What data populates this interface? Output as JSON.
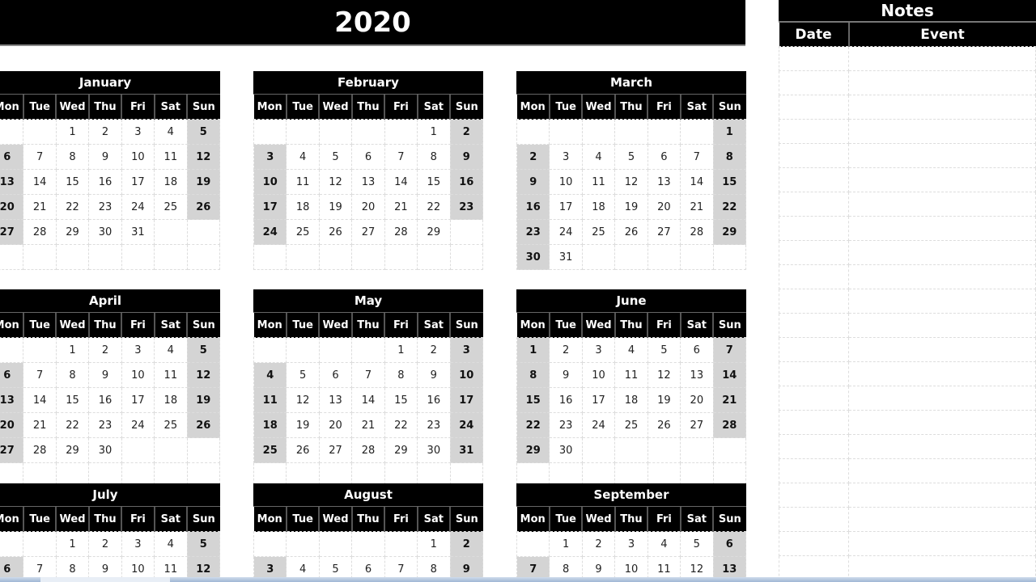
{
  "year_title": "2020",
  "weekday_headers": [
    "Mon",
    "Tue",
    "Wed",
    "Thu",
    "Fri",
    "Sat",
    "Sun"
  ],
  "months": [
    {
      "name": "January",
      "weeks": [
        [
          "",
          "",
          "1",
          "2",
          "3",
          "4",
          "5"
        ],
        [
          "6",
          "7",
          "8",
          "9",
          "10",
          "11",
          "12"
        ],
        [
          "13",
          "14",
          "15",
          "16",
          "17",
          "18",
          "19"
        ],
        [
          "20",
          "21",
          "22",
          "23",
          "24",
          "25",
          "26"
        ],
        [
          "27",
          "28",
          "29",
          "30",
          "31",
          "",
          ""
        ],
        [
          "",
          "",
          "",
          "",
          "",
          "",
          ""
        ]
      ]
    },
    {
      "name": "February",
      "weeks": [
        [
          "",
          "",
          "",
          "",
          "",
          "1",
          "2"
        ],
        [
          "3",
          "4",
          "5",
          "6",
          "7",
          "8",
          "9"
        ],
        [
          "10",
          "11",
          "12",
          "13",
          "14",
          "15",
          "16"
        ],
        [
          "17",
          "18",
          "19",
          "20",
          "21",
          "22",
          "23"
        ],
        [
          "24",
          "25",
          "26",
          "27",
          "28",
          "29",
          ""
        ],
        [
          "",
          "",
          "",
          "",
          "",
          "",
          ""
        ]
      ]
    },
    {
      "name": "March",
      "weeks": [
        [
          "",
          "",
          "",
          "",
          "",
          "",
          "1"
        ],
        [
          "2",
          "3",
          "4",
          "5",
          "6",
          "7",
          "8"
        ],
        [
          "9",
          "10",
          "11",
          "12",
          "13",
          "14",
          "15"
        ],
        [
          "16",
          "17",
          "18",
          "19",
          "20",
          "21",
          "22"
        ],
        [
          "23",
          "24",
          "25",
          "26",
          "27",
          "28",
          "29"
        ],
        [
          "30",
          "31",
          "",
          "",
          "",
          "",
          ""
        ]
      ]
    },
    {
      "name": "April",
      "weeks": [
        [
          "",
          "",
          "1",
          "2",
          "3",
          "4",
          "5"
        ],
        [
          "6",
          "7",
          "8",
          "9",
          "10",
          "11",
          "12"
        ],
        [
          "13",
          "14",
          "15",
          "16",
          "17",
          "18",
          "19"
        ],
        [
          "20",
          "21",
          "22",
          "23",
          "24",
          "25",
          "26"
        ],
        [
          "27",
          "28",
          "29",
          "30",
          "",
          "",
          ""
        ],
        [
          "",
          "",
          "",
          "",
          "",
          "",
          ""
        ]
      ]
    },
    {
      "name": "May",
      "weeks": [
        [
          "",
          "",
          "",
          "",
          "1",
          "2",
          "3"
        ],
        [
          "4",
          "5",
          "6",
          "7",
          "8",
          "9",
          "10"
        ],
        [
          "11",
          "12",
          "13",
          "14",
          "15",
          "16",
          "17"
        ],
        [
          "18",
          "19",
          "20",
          "21",
          "22",
          "23",
          "24"
        ],
        [
          "25",
          "26",
          "27",
          "28",
          "29",
          "30",
          "31"
        ],
        [
          "",
          "",
          "",
          "",
          "",
          "",
          ""
        ]
      ]
    },
    {
      "name": "June",
      "weeks": [
        [
          "1",
          "2",
          "3",
          "4",
          "5",
          "6",
          "7"
        ],
        [
          "8",
          "9",
          "10",
          "11",
          "12",
          "13",
          "14"
        ],
        [
          "15",
          "16",
          "17",
          "18",
          "19",
          "20",
          "21"
        ],
        [
          "22",
          "23",
          "24",
          "25",
          "26",
          "27",
          "28"
        ],
        [
          "29",
          "30",
          "",
          "",
          "",
          "",
          ""
        ],
        [
          "",
          "",
          "",
          "",
          "",
          "",
          ""
        ]
      ]
    },
    {
      "name": "July",
      "weeks": [
        [
          "",
          "",
          "1",
          "2",
          "3",
          "4",
          "5"
        ],
        [
          "6",
          "7",
          "8",
          "9",
          "10",
          "11",
          "12"
        ]
      ]
    },
    {
      "name": "August",
      "weeks": [
        [
          "",
          "",
          "",
          "",
          "",
          "1",
          "2"
        ],
        [
          "3",
          "4",
          "5",
          "6",
          "7",
          "8",
          "9"
        ]
      ]
    },
    {
      "name": "September",
      "weeks": [
        [
          "",
          "1",
          "2",
          "3",
          "4",
          "5",
          "6"
        ],
        [
          "7",
          "8",
          "9",
          "10",
          "11",
          "12",
          "13"
        ]
      ]
    }
  ],
  "notes": {
    "title": "Notes",
    "columns": [
      "Date",
      "Event"
    ],
    "row_count": 22
  }
}
